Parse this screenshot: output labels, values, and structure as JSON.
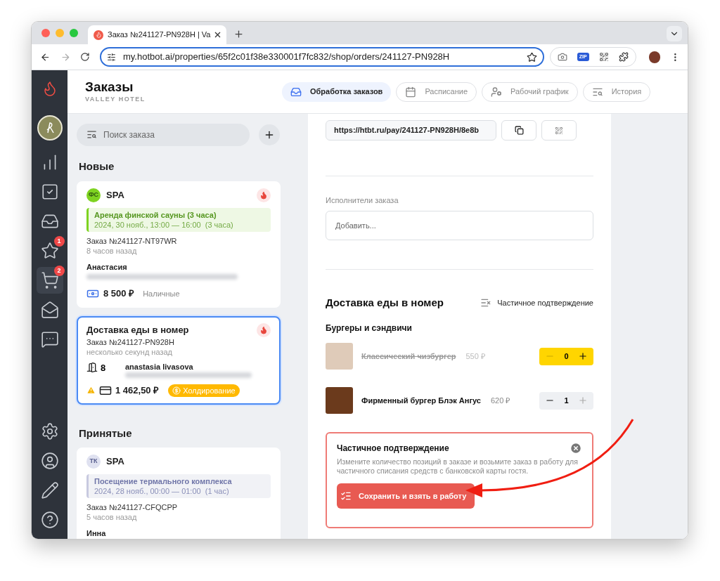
{
  "browser": {
    "tab_title": "Заказ №241127-PN928H | Va",
    "url": "my.hotbot.ai/properties/65f2c01f38e330001f7fc832/shop/orders/241127-PN928H",
    "zip_label": "ZIP"
  },
  "sidebar": {
    "items": [
      {
        "kind": "stats",
        "selected": false
      },
      {
        "kind": "tasks",
        "selected": false
      },
      {
        "kind": "inbox",
        "selected": false
      },
      {
        "kind": "reviews",
        "selected": false,
        "badge": "1"
      },
      {
        "kind": "cart",
        "selected": true,
        "badge": "2"
      },
      {
        "kind": "mail",
        "selected": false
      },
      {
        "kind": "chat",
        "selected": false
      }
    ],
    "bottom_items": [
      {
        "kind": "settings"
      },
      {
        "kind": "profile"
      },
      {
        "kind": "edit"
      },
      {
        "kind": "help"
      }
    ]
  },
  "header": {
    "title": "Заказы",
    "subtitle": "VALLEY HOTEL",
    "tabs": [
      {
        "kind": "orders",
        "label": "Обработка заказов",
        "selected": true
      },
      {
        "kind": "schedule",
        "label": "Расписание",
        "selected": false
      },
      {
        "kind": "staff",
        "label": "Рабочий график",
        "selected": false
      },
      {
        "kind": "history",
        "label": "История",
        "selected": false
      }
    ]
  },
  "search": {
    "placeholder": "Поиск заказа"
  },
  "sections": [
    {
      "title": "Новые",
      "orders": [
        {
          "kind": "booking",
          "selected": false,
          "initials": "ФС",
          "color": "#7ed321",
          "category": "SPA",
          "hot": true,
          "service": "Аренда финской сауны (3 часа)",
          "service_time": "2024, 30 нояб., 13:00 — 16:00  (3 часа)",
          "number": "Заказ №241127-NT97WR",
          "ago": "8 часов назад",
          "guest": "Анастасия",
          "amount": "8 500 ₽",
          "payment": "Наличные"
        },
        {
          "kind": "delivery",
          "selected": true,
          "title": "Доставка еды в номер",
          "hot": true,
          "number": "Заказ №241127-PN928H",
          "ago": "несколько секунд назад",
          "room": "8",
          "guest": "anastasia livasova",
          "warning": true,
          "amount": "1 462,50 ₽",
          "status": "Холдирование"
        }
      ]
    },
    {
      "title": "Принятые",
      "orders": [
        {
          "kind": "booking",
          "selected": false,
          "initials": "ТК",
          "color": "#dfe1f0",
          "category": "SPA",
          "hot": false,
          "service": "Посещение термального комплекса",
          "service_time": "2024, 28 нояб., 00:00 — 01:00  (1 час)",
          "number": "Заказ №241127-CFQCPP",
          "ago": "5 часов назад",
          "guest": "Инна"
        }
      ]
    }
  ],
  "detail": {
    "payment_link": "https://htbt.ru/pay/241127-PN928H/8e8b",
    "executors_label": "Исполнители заказа",
    "executors_placeholder": "Добавить...",
    "section_title": "Доставка еды в номер",
    "partial_toggle": "Частичное подтверждение",
    "category": "Бургеры и сэндвичи",
    "items": [
      {
        "name": "Классический чизбургер",
        "price": "550 ₽",
        "quantity": "0",
        "removed": true
      },
      {
        "name": "Фирменный бургер Блэк Ангус",
        "price": "620 ₽",
        "quantity": "1",
        "removed": false
      }
    ],
    "partial_panel": {
      "title": "Частичное подтверждение",
      "text": "Измените количество позиций в заказе и возьмите заказ в работу для частичного списания средств с банковской карты гостя.",
      "button": "Сохранить и взять в работу"
    }
  }
}
